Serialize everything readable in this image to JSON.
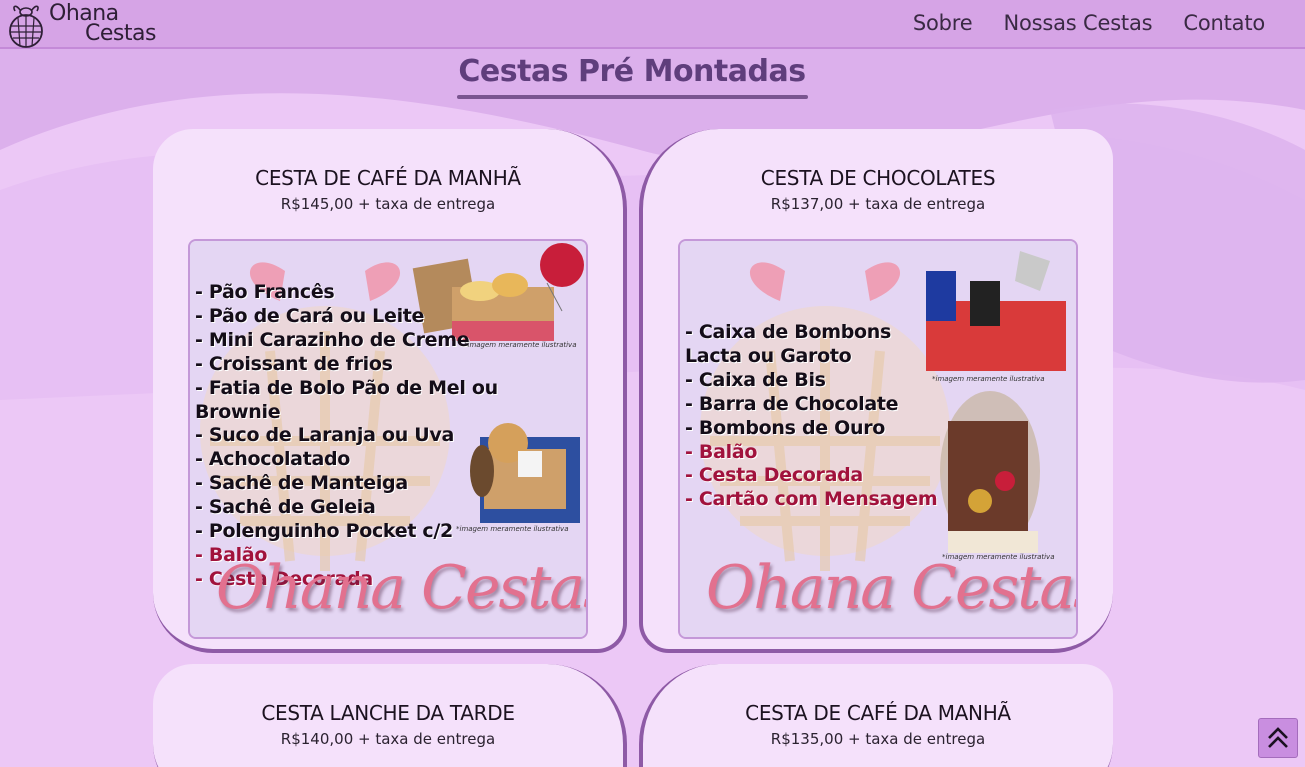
{
  "brand": {
    "line1": "Ohana",
    "line2": "Cestas"
  },
  "nav": {
    "items": [
      "Sobre",
      "Nossas Cestas",
      "Contato"
    ]
  },
  "page": {
    "title": "Cestas Pré Montadas"
  },
  "cards": [
    {
      "title": "CESTA DE CAFÉ DA MANHÃ",
      "price": "R$145,00 + taxa de entrega",
      "items": [
        "- Pão Francês",
        "- Pão de Cará ou Leite",
        "- Mini Carazinho de Creme",
        "- Croissant de frios",
        "- Fatia de Bolo Pão de Mel ou Brownie",
        "- Suco de Laranja ou Uva",
        "- Achocolatado",
        "- Sachê de Manteiga",
        "- Sachê de Geleia",
        "- Polenguinho Pocket c/2"
      ],
      "extras": [
        "- Balão",
        "- Cesta Decorada"
      ],
      "disclaimer": "*imagem meramente ilustrativa",
      "image_brand": "Ohana Cestas"
    },
    {
      "title": "CESTA DE CHOCOLATES",
      "price": "R$137,00 + taxa de entrega",
      "items": [
        "- Caixa de Bombons",
        "Lacta ou Garoto",
        "- Caixa de Bis",
        "- Barra de Chocolate",
        "- Bombons de Ouro"
      ],
      "extras": [
        "- Balão",
        "- Cesta Decorada",
        "- Cartão com Mensagem"
      ],
      "disclaimer": "*imagem meramente ilustrativa",
      "image_brand": "Ohana Cestas"
    },
    {
      "title": "CESTA LANCHE DA TARDE",
      "price": "R$140,00 + taxa de entrega"
    },
    {
      "title": "CESTA DE CAFÉ DA MANHÃ",
      "price": "R$135,00 + taxa de entrega"
    }
  ],
  "colors": {
    "topbar": "#d6a4e6",
    "background": "#ecc8f6",
    "card": "#f5e1fb",
    "accent": "#8e5aa6",
    "title": "#5f3e7c",
    "extra_item": "#a1123c",
    "script": "#e2718f"
  },
  "icons": {
    "logo": "basket-logo-icon",
    "scroll_top": "double-chevron-up-icon"
  }
}
